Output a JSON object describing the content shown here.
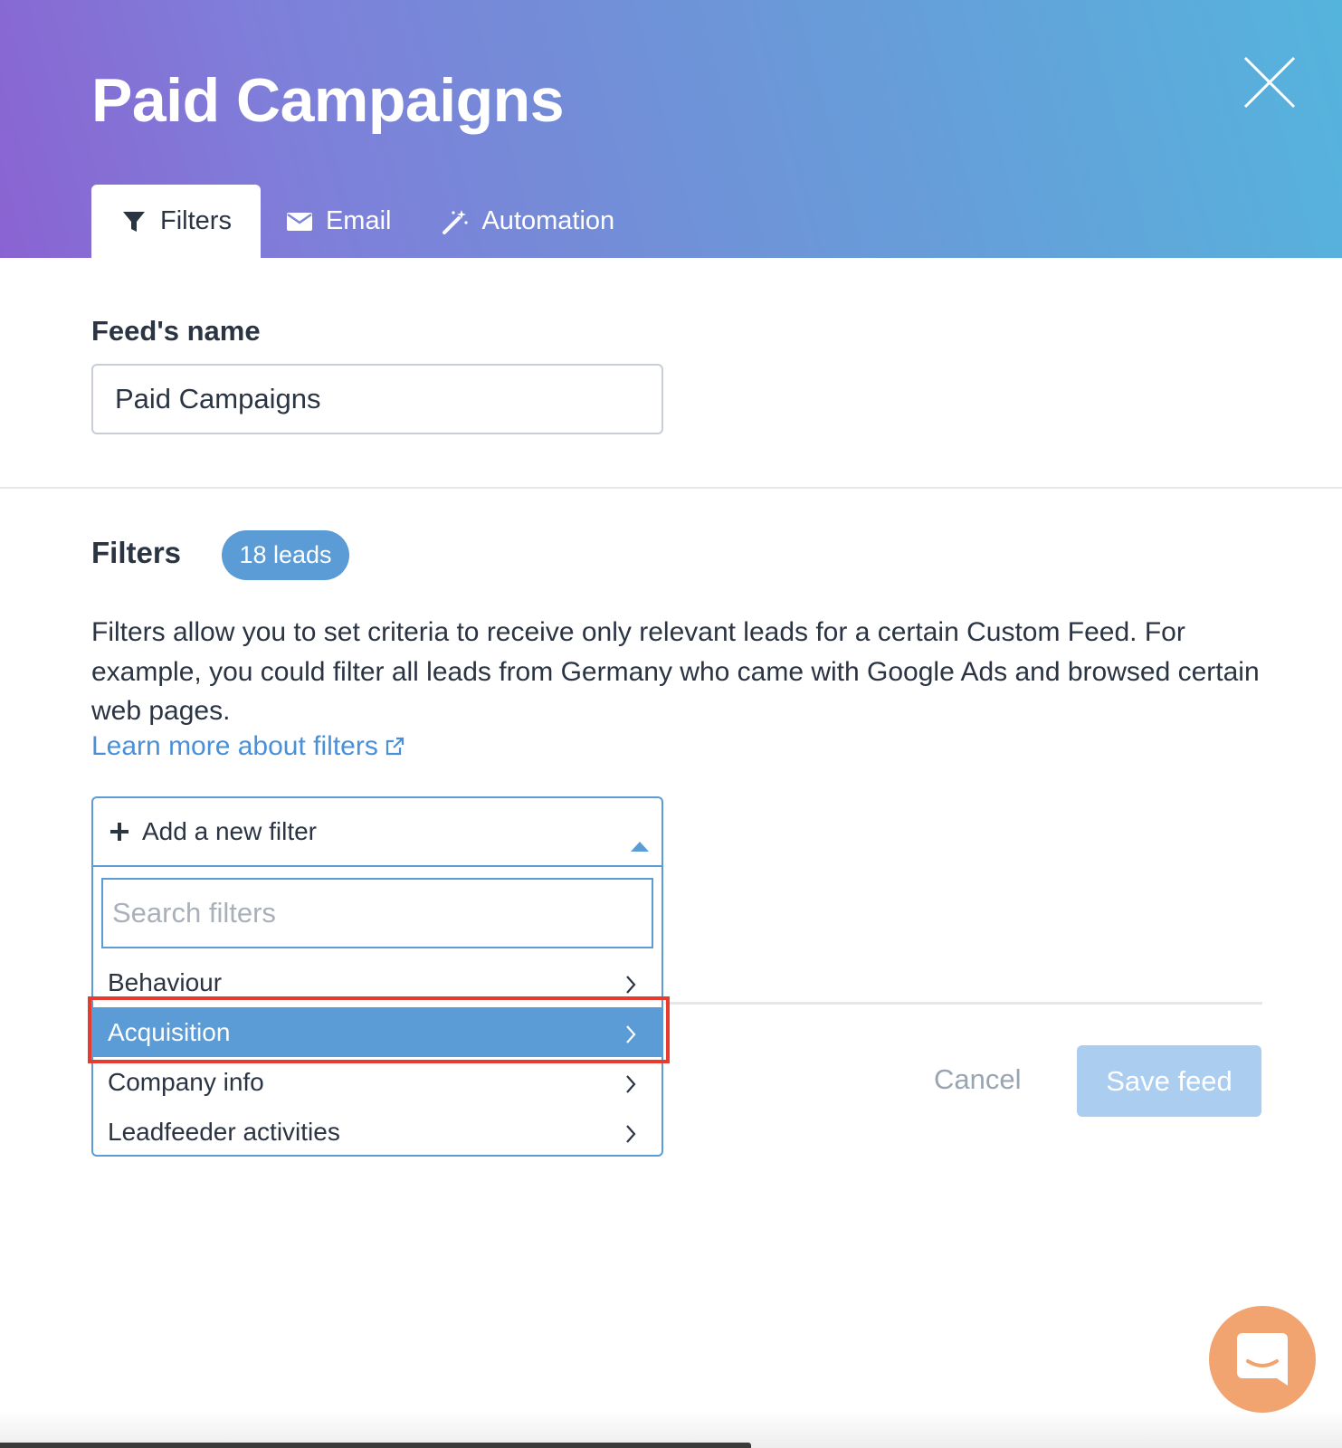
{
  "header": {
    "title": "Paid Campaigns",
    "tabs": [
      {
        "label": "Filters",
        "icon": "filter-icon",
        "active": true
      },
      {
        "label": "Email",
        "icon": "envelope-icon",
        "active": false
      },
      {
        "label": "Automation",
        "icon": "magic-wand-icon",
        "active": false
      }
    ]
  },
  "feed_name": {
    "label": "Feed's name",
    "value": "Paid Campaigns"
  },
  "filters": {
    "heading": "Filters",
    "badge": "18 leads",
    "description": "Filters allow you to set criteria to receive only relevant leads for a certain Custom Feed. For example, you could filter all leads from Germany who came with Google Ads and browsed certain web pages.",
    "learn_more": "Learn more about filters"
  },
  "dropdown": {
    "label": "Add a new filter",
    "search_placeholder": "Search filters",
    "items": [
      {
        "label": "Behaviour",
        "selected": false
      },
      {
        "label": "Acquisition",
        "selected": true
      },
      {
        "label": "Company info",
        "selected": false
      },
      {
        "label": "Leadfeeder activities",
        "selected": false
      }
    ]
  },
  "actions": {
    "cancel": "Cancel",
    "save": "Save feed"
  },
  "colors": {
    "accent": "#5b9bd6",
    "link": "#4a90d9",
    "highlight": "#e63b2e",
    "chat": "#f2a470",
    "save_disabled": "#abcdf0"
  }
}
